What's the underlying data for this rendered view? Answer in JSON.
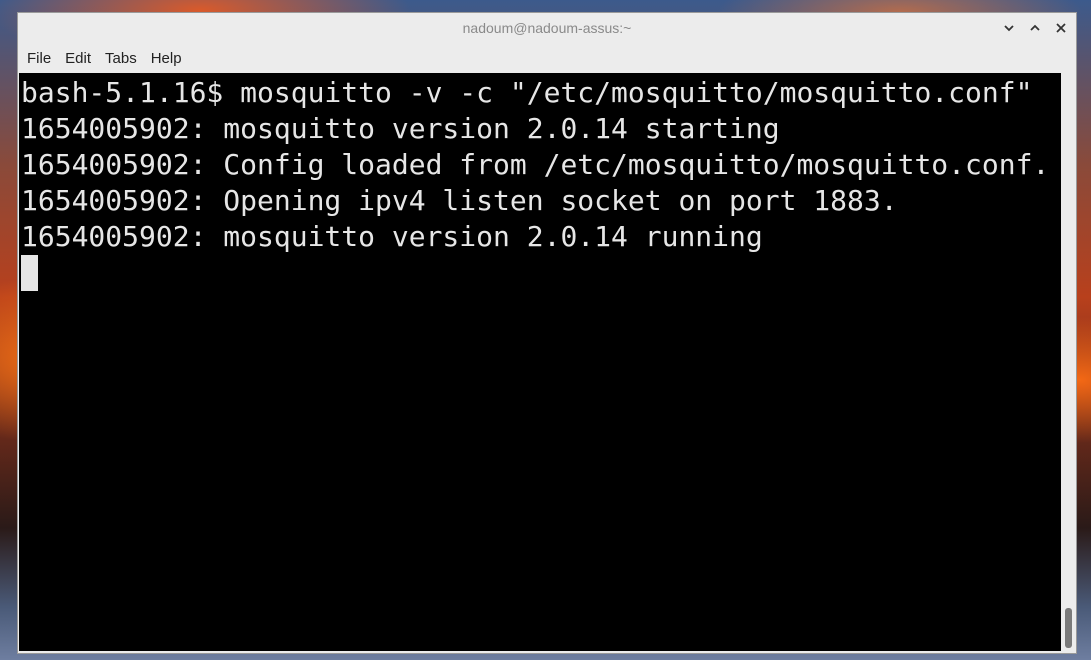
{
  "window": {
    "title": "nadoum@nadoum-assus:~",
    "controls": {
      "minimize_icon": "chevron-down-icon",
      "maximize_icon": "chevron-up-icon",
      "close_icon": "close-icon"
    }
  },
  "menubar": {
    "items": [
      {
        "label": "File"
      },
      {
        "label": "Edit"
      },
      {
        "label": "Tabs"
      },
      {
        "label": "Help"
      }
    ]
  },
  "terminal": {
    "lines": [
      "bash-5.1.16$ mosquitto -v -c \"/etc/mosquitto/mosquitto.conf\"",
      "1654005902: mosquitto version 2.0.14 starting",
      "1654005902: Config loaded from /etc/mosquitto/mosquitto.conf.",
      "1654005902: Opening ipv4 listen socket on port 1883.",
      "1654005902: mosquitto version 2.0.14 running"
    ],
    "background": "#000000",
    "foreground": "#e6e6e6"
  }
}
